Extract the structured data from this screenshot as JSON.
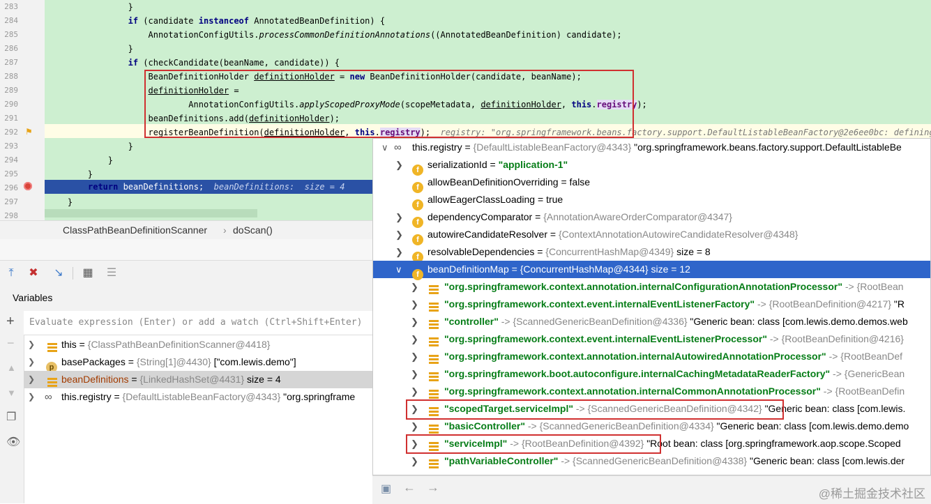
{
  "editor": {
    "line_numbers": [
      "283",
      "284",
      "285",
      "286",
      "287",
      "288",
      "289",
      "290",
      "291",
      "292",
      "293",
      "294",
      "295",
      "296",
      "297",
      "298"
    ],
    "inline_hint_292": "registry: \"org.springframework.beans.factory.support.DefaultListableBeanFactory@2e6ee0bc: defining bean",
    "inline_hint_296": "beanDefinitions:  size = 4"
  },
  "breadcrumb": {
    "class": "ClassPathBeanDefinitionScanner",
    "method": "doScan()"
  },
  "variables": {
    "title": "Variables",
    "eval_placeholder": "Evaluate expression (Enter) or add a watch (Ctrl+Shift+Enter)",
    "rows": [
      {
        "name": "this",
        "value": "{ClassPathBeanDefinitionScanner@4418}",
        "extra": ""
      },
      {
        "name": "basePackages",
        "value": "{String[1]@4430}",
        "extra": "[\"com.lewis.demo\"]"
      },
      {
        "name": "beanDefinitions",
        "value": "{LinkedHashSet@4431}",
        "extra": "size = 4"
      },
      {
        "name": "this.registry",
        "value": "{DefaultListableBeanFactory@4343}",
        "extra": "\"org.springframe"
      }
    ]
  },
  "popup": {
    "root": {
      "name": "this.registry",
      "value": "{DefaultListableBeanFactory@4343}",
      "extra": "\"org.springframework.beans.factory.support.DefaultListableBe"
    },
    "fields": [
      {
        "name": "serializationId",
        "value": "\"application-1\"",
        "extra": ""
      },
      {
        "name": "allowBeanDefinitionOverriding",
        "value": "false",
        "extra": ""
      },
      {
        "name": "allowEagerClassLoading",
        "value": "true",
        "extra": ""
      },
      {
        "name": "dependencyComparator",
        "value": "{AnnotationAwareOrderComparator@4347}",
        "extra": ""
      },
      {
        "name": "autowireCandidateResolver",
        "value": "{ContextAnnotationAutowireCandidateResolver@4348}",
        "extra": ""
      },
      {
        "name": "resolvableDependencies",
        "value": "{ConcurrentHashMap@4349}",
        "extra": "size = 8"
      },
      {
        "name": "beanDefinitionMap",
        "value": "{ConcurrentHashMap@4344}",
        "extra": "size = 12"
      }
    ],
    "entries": [
      {
        "key": "\"org.springframework.context.annotation.internalConfigurationAnnotationProcessor\"",
        "value": "{RootBean",
        "extra": ""
      },
      {
        "key": "\"org.springframework.context.event.internalEventListenerFactory\"",
        "value": "{RootBeanDefinition@4217}",
        "extra": "\"R"
      },
      {
        "key": "\"controller\"",
        "value": "{ScannedGenericBeanDefinition@4336}",
        "extra": "\"Generic bean: class [com.lewis.demo.demos.web"
      },
      {
        "key": "\"org.springframework.context.event.internalEventListenerProcessor\"",
        "value": "{RootBeanDefinition@4216}",
        "extra": ""
      },
      {
        "key": "\"org.springframework.context.annotation.internalAutowiredAnnotationProcessor\"",
        "value": "{RootBeanDef",
        "extra": ""
      },
      {
        "key": "\"org.springframework.boot.autoconfigure.internalCachingMetadataReaderFactory\"",
        "value": "{GenericBean",
        "extra": ""
      },
      {
        "key": "\"org.springframework.context.annotation.internalCommonAnnotationProcessor\"",
        "value": "{RootBeanDefin",
        "extra": ""
      },
      {
        "key": "\"scopedTarget.serviceImpl\"",
        "value": "{ScannedGenericBeanDefinition@4342}",
        "extra": "\"Generic bean: class [com.lewis."
      },
      {
        "key": "\"basicController\"",
        "value": "{ScannedGenericBeanDefinition@4334}",
        "extra": "\"Generic bean: class [com.lewis.demo.demo"
      },
      {
        "key": "\"serviceImpl\"",
        "value": "{RootBeanDefinition@4392}",
        "extra": "\"Root bean: class [org.springframework.aop.scope.Scoped"
      },
      {
        "key": "\"pathVariableController\"",
        "value": "{ScannedGenericBeanDefinition@4338}",
        "extra": "\"Generic bean: class [com.lewis.der"
      }
    ],
    "arrow": "->",
    "eq": "="
  },
  "watermark": "@稀土掘金技术社区",
  "colors": {
    "editor_bg": "#cdefd0",
    "selection": "#2f65ca",
    "highlight_box": "#d03030"
  }
}
